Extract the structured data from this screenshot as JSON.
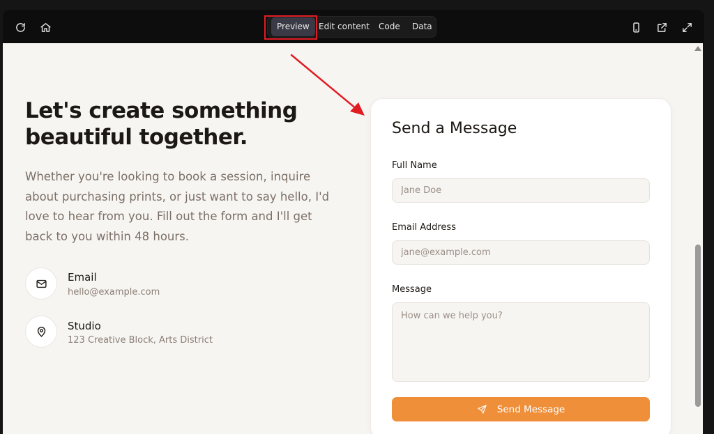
{
  "toolbar": {
    "tabs": [
      {
        "label": "Preview",
        "active": true
      },
      {
        "label": "Edit content",
        "active": false
      },
      {
        "label": "Code",
        "active": false
      },
      {
        "label": "Data",
        "active": false
      }
    ],
    "left_icons": [
      "refresh-icon",
      "home-icon"
    ],
    "right_icons": [
      "mobile-icon",
      "external-link-icon",
      "expand-icon"
    ],
    "highlight_color": "#e11d24"
  },
  "hero": {
    "headline_line1": "Let's create something",
    "headline_line2": "beautiful together.",
    "intro": "Whether you're looking to book a session, inquire about purchasing prints, or just want to say hello, I'd love to hear from you. Fill out the form and I'll get back to you within 48 hours."
  },
  "contacts": [
    {
      "icon": "mail-icon",
      "title": "Email",
      "value": "hello@example.com"
    },
    {
      "icon": "map-pin-icon",
      "title": "Studio",
      "value": "123 Creative Block, Arts District"
    }
  ],
  "form": {
    "title": "Send a Message",
    "name_label": "Full Name",
    "name_placeholder": "Jane Doe",
    "email_label": "Email Address",
    "email_placeholder": "jane@example.com",
    "message_label": "Message",
    "message_placeholder": "How can we help you?",
    "submit_label": "Send Message",
    "accent_color": "#ef8f39"
  },
  "annotation": {
    "arrow_color": "#e11d24"
  }
}
